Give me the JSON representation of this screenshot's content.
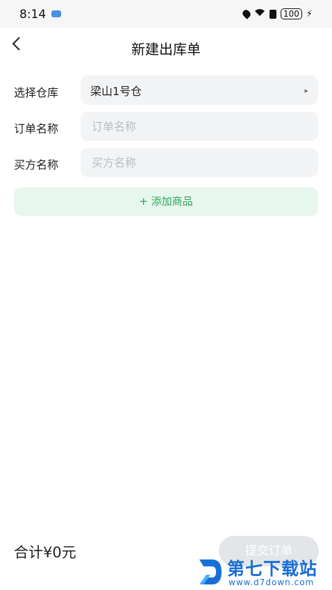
{
  "status_bar": {
    "time": "8:14",
    "battery": "100"
  },
  "header": {
    "back_icon": "<",
    "title": "新建出库单"
  },
  "form": {
    "warehouse": {
      "label": "选择仓库",
      "value": "梁山1号仓",
      "arrow_icon": "▸"
    },
    "order_name": {
      "label": "订单名称",
      "value": "",
      "placeholder": "订单名称"
    },
    "buyer_name": {
      "label": "买方名称",
      "value": "",
      "placeholder": "买方名称"
    }
  },
  "add_product_label": "+ 添加商品",
  "footer": {
    "total": "合计¥0元",
    "submit_label": "提交订单"
  },
  "watermark": {
    "text": "第七下载站",
    "url": "www.d7down.com"
  },
  "colors": {
    "accent_green": "#2fa45a",
    "add_button_bg": "#e8f7ee",
    "field_bg": "#f3f4f6",
    "disabled_button": "#e3e5e8",
    "watermark_blue": "#1a6fd6"
  }
}
